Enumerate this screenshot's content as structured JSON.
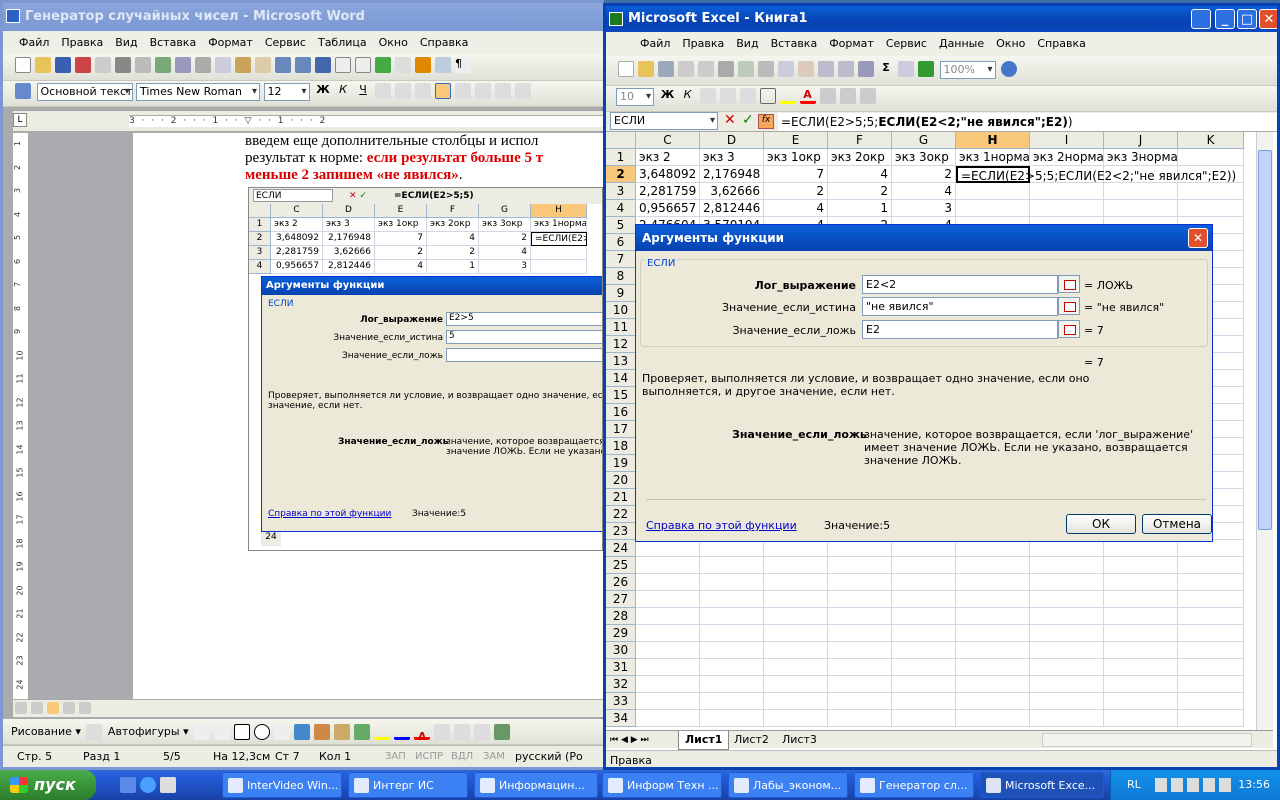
{
  "word": {
    "title": "Генератор случайных чисел - Microsoft Word",
    "menu": [
      "Файл",
      "Правка",
      "Вид",
      "Вставка",
      "Формат",
      "Сервис",
      "Таблица",
      "Окно",
      "Справка"
    ],
    "style": "Основной текст",
    "font": "Times New Roman",
    "size": "12",
    "line1": "введем еще дополнительные столбцы и испол",
    "line2a": "результат к норме: ",
    "line2b": "если результат больше 5 т",
    "line3": "меньше 2 запишем «не явился»",
    "line3end": ".",
    "status": {
      "page": "Стр. 5",
      "sec": "Разд 1",
      "pages": "5/5",
      "at": "На 12,3см",
      "line": "Ст 7",
      "col": "Кол 1",
      "rec": "ЗАП",
      "trk": "ИСПР",
      "ext": "ВДЛ",
      "ovr": "ЗАМ",
      "lang": "русский (Ро"
    },
    "drawing": "Рисование",
    "autoshapes": "Автофигуры",
    "ruler_v": [
      "1",
      "2",
      "3",
      "4",
      "5",
      "6",
      "7",
      "8",
      "9",
      "10",
      "11",
      "12",
      "13",
      "14",
      "15",
      "16",
      "17",
      "18",
      "19",
      "20",
      "21",
      "22",
      "23",
      "24"
    ],
    "ruler_h": [
      "3",
      "2",
      "1",
      "1",
      "2"
    ],
    "ruler_corner": "L",
    "emb": {
      "namebox": "ЕСЛИ",
      "formula": "=ЕСЛИ(E2>5;5)",
      "cols": [
        "C",
        "D",
        "E",
        "F",
        "G",
        "H"
      ],
      "rows": [
        [
          "1",
          "экз 2",
          "экз 3",
          "экз 1окр",
          "экз 2окр",
          "экз 3окр",
          "экз 1норма_э"
        ],
        [
          "2",
          "3,648092",
          "2,176948",
          "7",
          "4",
          "2",
          "=ЕСЛИ(E2>5;"
        ],
        [
          "3",
          "2,281759",
          "3,62666",
          "2",
          "2",
          "4",
          ""
        ],
        [
          "4",
          "0,956657",
          "2,812446",
          "4",
          "1",
          "3",
          ""
        ]
      ],
      "dlg_title": "Аргументы функции",
      "group": "ЕСЛИ",
      "l1": "Лог_выражение",
      "v1": "E2>5",
      "l2": "Значение_если_истина",
      "v2": "5",
      "l3": "Значение_если_ложь",
      "v3": "",
      "desc": "Проверяет, выполняется ли условие, и возвращает одно значение, если оно вы",
      "desc2": "значение, если нет.",
      "arg": "Значение_если_ложь",
      "argdesc": "значение, которое возвращается, ес",
      "argdesc2": "значение ЛОЖЬ. Если не указано, воз",
      "help": "Справка по этой функции",
      "result": "Значение:5",
      "row24": "24"
    }
  },
  "excel": {
    "title": "Microsoft Excel - Книга1",
    "menu": [
      "Файл",
      "Правка",
      "Вид",
      "Вставка",
      "Формат",
      "Сервис",
      "Данные",
      "Окно",
      "Справка"
    ],
    "zoom": "100%",
    "fontsize": "10",
    "namebox": "ЕСЛИ",
    "formula_a": "=ЕСЛИ(E2>5;5;",
    "formula_b": "ЕСЛИ(E2<2;\"не явился\";E2)",
    "formula_c": ")",
    "cols": [
      "C",
      "D",
      "E",
      "F",
      "G",
      "H",
      "I",
      "J",
      "K"
    ],
    "row1": [
      "экз 2",
      "экз 3",
      "экз 1окр",
      "экз 2окр",
      "экз 3окр",
      "экз 1норма",
      "экз 2норма",
      "экз 3норма",
      ""
    ],
    "row2": [
      "3,648092",
      "2,176948",
      "7",
      "4",
      "2"
    ],
    "row3": [
      "2,281759",
      "3,62666",
      "2",
      "2",
      "4"
    ],
    "row4": [
      "0,956657",
      "2,812446",
      "4",
      "1",
      "3"
    ],
    "row5": [
      "2,476604",
      "3,570194",
      "4",
      "2",
      "4"
    ],
    "h2": "=ЕСЛИ(E2>5;5;ЕСЛИ(E2<2;\"не явился\";E2))",
    "rownums": [
      "1",
      "2",
      "3",
      "4",
      "5",
      "6",
      "7",
      "8",
      "9",
      "10",
      "11",
      "12",
      "13",
      "14",
      "15",
      "16",
      "17",
      "18",
      "19",
      "20",
      "21",
      "22",
      "23",
      "24",
      "25",
      "26",
      "27",
      "28",
      "29",
      "30",
      "31",
      "32",
      "33",
      "34"
    ],
    "sheets": [
      "Лист1",
      "Лист2",
      "Лист3"
    ],
    "status": "Правка",
    "dlg": {
      "title": "Аргументы функции",
      "group": "ЕСЛИ",
      "l1": "Лог_выражение",
      "v1": "E2<2",
      "r1": "= ЛОЖЬ",
      "l2": "Значение_если_истина",
      "v2": "\"не явился\"",
      "r2": "= \"не явился\"",
      "l3": "Значение_если_ложь",
      "v3": "E2",
      "r3": "= 7",
      "total": "= 7",
      "desc": "Проверяет, выполняется ли условие, и возвращает одно значение, если оно выполняется, и другое значение, если нет.",
      "arg": "Значение_если_ложь",
      "argdesc": "значение, которое возвращается, если 'лог_выражение' имеет значение ЛОЖЬ. Если не указано, возвращается значение ЛОЖЬ.",
      "help": "Справка по этой функции",
      "result": "Значение:5",
      "ok": "ОК",
      "cancel": "Отмена"
    }
  },
  "taskbar": {
    "start": "пуск",
    "items": [
      "InterVideo Win...",
      "Интерг ИС",
      "Информацин...",
      "Информ Техн ...",
      "Лабы_эконом...",
      "Генератор сл...",
      "Microsoft Exce..."
    ],
    "lang": "RL",
    "clock": "13:56"
  },
  "colors": {
    "xp_blue": "#0a5fd8",
    "taskbar": "#245edb",
    "start": "#3c9a3c",
    "sel_col": "#f9c87a"
  }
}
